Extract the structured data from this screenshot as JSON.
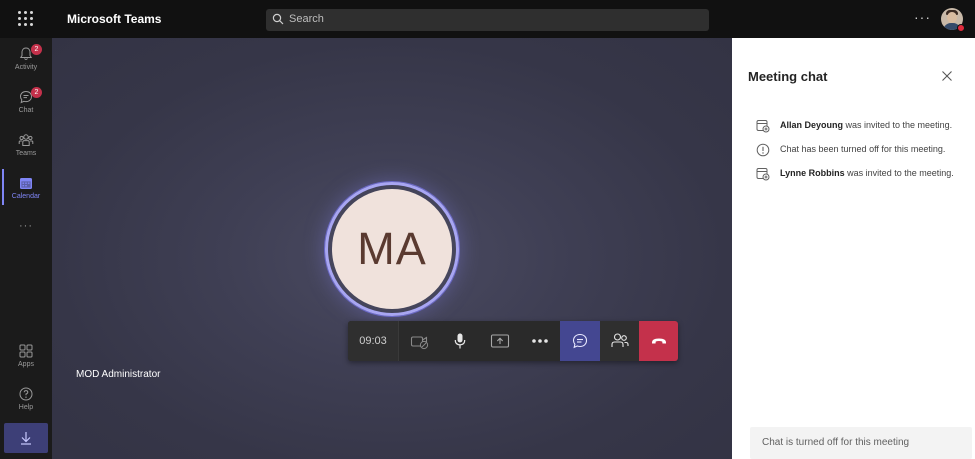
{
  "topbar": {
    "app_title": "Microsoft Teams",
    "search_placeholder": "Search",
    "more_label": "···"
  },
  "rail": {
    "items": [
      {
        "label": "Activity",
        "badge": "2",
        "icon": "bell-icon"
      },
      {
        "label": "Chat",
        "badge": "2",
        "icon": "chat-icon"
      },
      {
        "label": "Teams",
        "badge": "",
        "icon": "teams-icon"
      },
      {
        "label": "Calendar",
        "badge": "",
        "icon": "calendar-icon",
        "active": true
      },
      {
        "label": "Apps",
        "badge": "",
        "icon": "apps-icon"
      },
      {
        "label": "Help",
        "badge": "",
        "icon": "help-icon"
      }
    ],
    "more": "···"
  },
  "stage": {
    "initials": "MA",
    "participant_name": "MOD Administrator",
    "timer": "09:03"
  },
  "panel": {
    "title": "Meeting chat",
    "messages": [
      {
        "name": "Allan Deyoung",
        "text": " was invited to the meeting.",
        "icon": "person-add-icon"
      },
      {
        "name": "",
        "text": "Chat has been turned off for this meeting.",
        "icon": "info-icon"
      },
      {
        "name": "Lynne Robbins",
        "text": " was invited to the meeting.",
        "icon": "person-add-icon"
      }
    ],
    "footer": "Chat is turned off for this meeting"
  },
  "colors": {
    "accent": "#7f85f5",
    "hangup": "#c4314b",
    "badge": "#c4314b",
    "avatar_ring": "#a8a6f2"
  }
}
